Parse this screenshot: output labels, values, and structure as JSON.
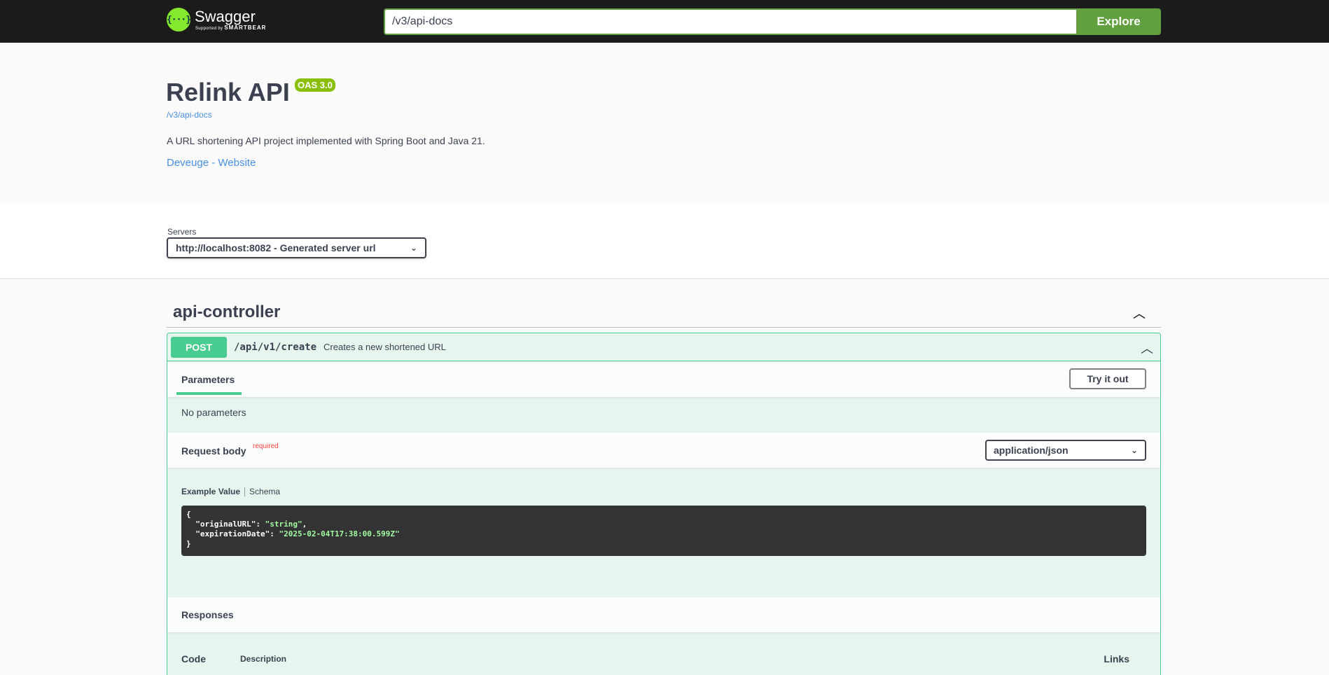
{
  "topbar": {
    "logo_name": "Swagger",
    "logo_sub_prefix": "Supported by",
    "logo_sub_brand": "SMARTBEAR",
    "url_value": "/v3/api-docs",
    "explore_label": "Explore"
  },
  "info": {
    "title": "Relink API",
    "oas_badge": "OAS 3.0",
    "api_link": "/v3/api-docs",
    "description": "A URL shortening API project implemented with Spring Boot and Java 21.",
    "website_link": "Deveuge - Website"
  },
  "servers": {
    "label": "Servers",
    "selected": "http://localhost:8082 - Generated server url"
  },
  "tag": {
    "name": "api-controller"
  },
  "operation": {
    "method": "POST",
    "path": "/api/v1/create",
    "summary": "Creates a new shortened URL",
    "parameters_tab": "Parameters",
    "try_it_out": "Try it out",
    "no_parameters": "No parameters",
    "request_body_label": "Request body",
    "required_label": "required",
    "media_type": "application/json",
    "example_value_tab": "Example Value",
    "schema_tab": "Schema",
    "example": {
      "key1": "\"originalURL\"",
      "val1": "\"string\"",
      "key2": "\"expirationDate\"",
      "val2": "\"2025-02-04T17:38:00.599Z\""
    },
    "responses_label": "Responses",
    "col_code": "Code",
    "col_description": "Description",
    "col_links": "Links"
  },
  "colors": {
    "topbar_bg": "#1b1b1b",
    "explore_green": "#62a03f",
    "post_green": "#49cc90",
    "oas_badge": "#89bf04",
    "link_blue": "#4990e2",
    "required_red": "#f93e3e"
  },
  "icons": {
    "logo": "swagger-logo-icon",
    "collapse": "chevron-up-icon",
    "dropdown": "chevron-down-icon"
  }
}
